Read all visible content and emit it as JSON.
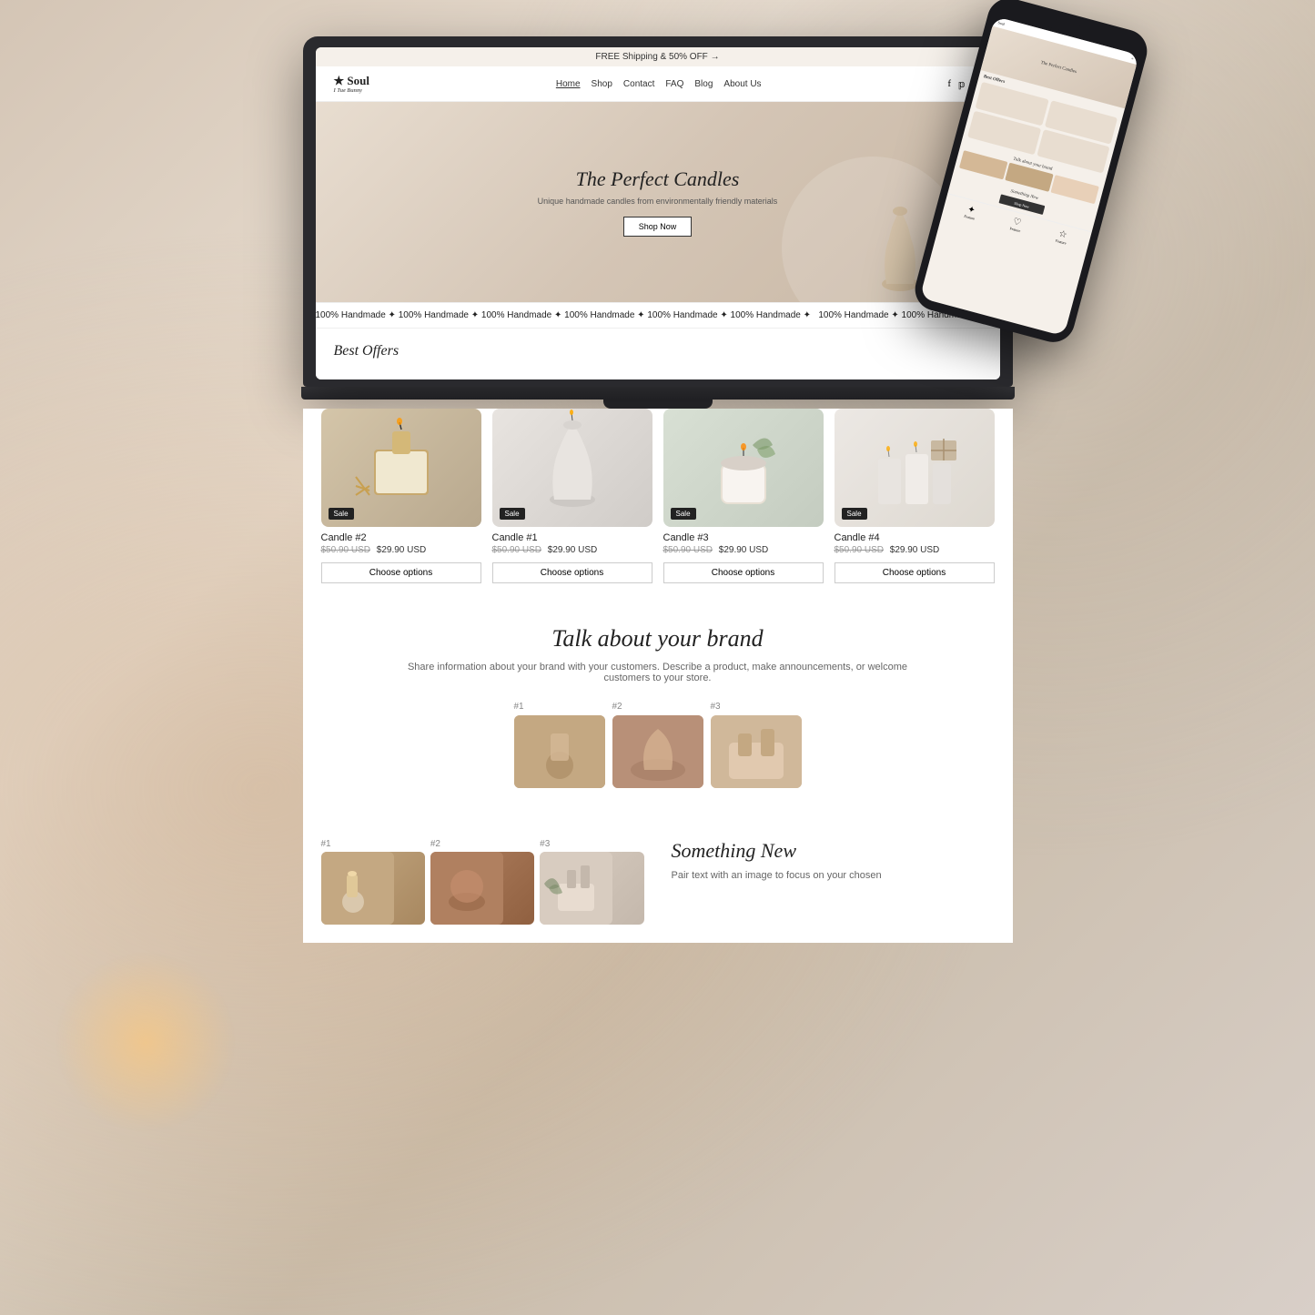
{
  "site": {
    "announcement": "FREE Shipping & 50% OFF →",
    "logo": "Soul",
    "logo_sub": "I Tue Bunny",
    "nav": {
      "items": [
        {
          "label": "Home",
          "active": true
        },
        {
          "label": "Shop",
          "has_dropdown": true
        },
        {
          "label": "Contact"
        },
        {
          "label": "FAQ"
        },
        {
          "label": "Blog"
        },
        {
          "label": "About Us"
        }
      ]
    },
    "hero": {
      "title": "The Perfect Candles",
      "subtitle": "Unique handmade candles from environmentally friendly materials",
      "cta": "Shop Now"
    },
    "marquee": "100% Handmade ✦ 100% Handmade ✦ 100% Handmade ✦ 100% Handmade ✦ 100% Handmade ✦ 100% Handmade ✦ 100% Handmade ✦ 100% Handmade ✦ 100% Handmade ✦ ",
    "best_offers": {
      "title": "Best Offers",
      "products": [
        {
          "name": "Candle #2",
          "price_original": "$50.90 USD",
          "price_sale": "$29.90 USD",
          "badge": "Sale",
          "cta": "Choose options"
        },
        {
          "name": "Candle #1",
          "price_original": "$50.90 USD",
          "price_sale": "$29.90 USD",
          "badge": "Sale",
          "cta": "Choose options"
        },
        {
          "name": "Candle #3",
          "price_original": "$50.90 USD",
          "price_sale": "$29.90 USD",
          "badge": "Sale",
          "cta": "Choose options"
        },
        {
          "name": "Candle #4",
          "price_original": "$50.90 USD",
          "price_sale": "$29.90 USD",
          "badge": "Sale",
          "cta": "Choose options"
        }
      ]
    },
    "brand": {
      "title": "Talk about your brand",
      "description": "Share information about your brand with your customers. Describe a product, make announcements, or welcome customers to your store.",
      "images": [
        {
          "number": "#1"
        },
        {
          "number": "#2"
        },
        {
          "number": "#3"
        }
      ]
    },
    "something_new": {
      "title": "Something New",
      "description": "Pair text with an image to focus on your chosen"
    }
  }
}
